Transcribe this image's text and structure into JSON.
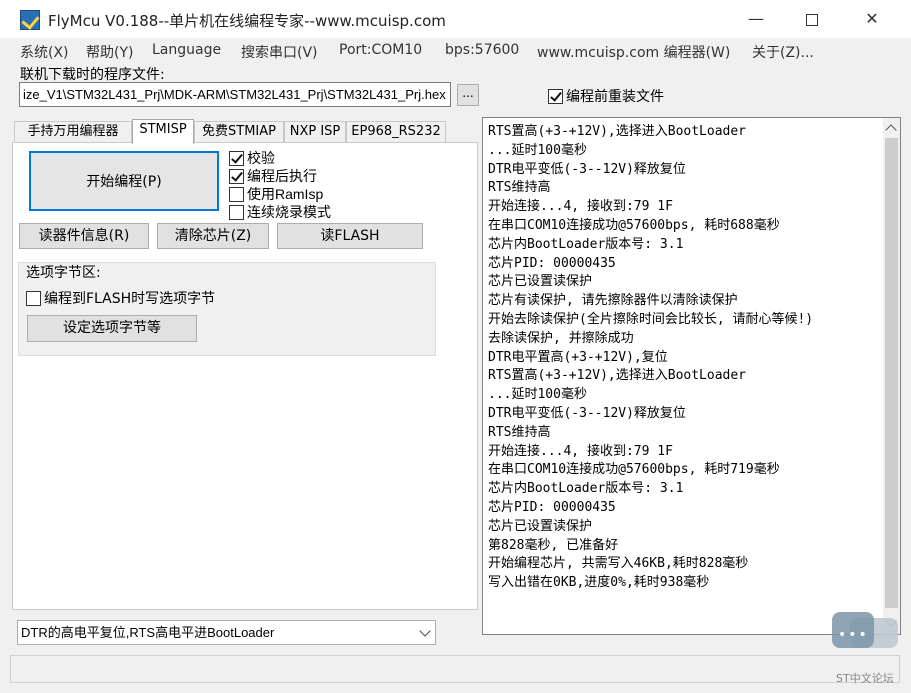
{
  "window": {
    "title": "FlyMcu V0.188--单片机在线编程专家--www.mcuisp.com",
    "minimize": "—",
    "close": "✕"
  },
  "menu": [
    "系统(X)",
    "帮助(Y)",
    "Language",
    "搜索串口(V)",
    "Port:COM10",
    "bps:57600",
    "www.mcuisp.com 编程器(W)",
    "关于(Z)..."
  ],
  "file": {
    "label": "联机下载时的程序文件:",
    "path": "ize_V1\\STM32L431_Prj\\MDK-ARM\\STM32L431_Prj\\STM32L431_Prj.hex",
    "browse": "...",
    "reload_label": "编程前重装文件",
    "reload_checked": true
  },
  "tabs": [
    "手持万用编程器",
    "STMISP",
    "免费STMIAP",
    "NXP ISP",
    "EP968_RS232"
  ],
  "active_tab": "STMISP",
  "stmisp": {
    "start_button": "开始编程(P)",
    "options": [
      {
        "label": "校验",
        "checked": true
      },
      {
        "label": "编程后执行",
        "checked": true
      },
      {
        "label": "使用RamIsp",
        "checked": false
      },
      {
        "label": "连续烧录模式",
        "checked": false
      }
    ],
    "read_info": "读器件信息(R)",
    "erase_chip": "清除芯片(Z)",
    "read_flash": "读FLASH",
    "option_group_title": "选项字节区:",
    "write_option_label": "编程到FLASH时写选项字节",
    "write_option_checked": false,
    "set_option_button": "设定选项字节等"
  },
  "reset_mode": "DTR的高电平复位,RTS高电平进BootLoader",
  "log_lines": [
    "RTS置高(+3-+12V),选择进入BootLoader",
    "...延时100毫秒",
    "DTR电平变低(-3--12V)释放复位",
    "RTS维持高",
    "开始连接...4, 接收到:79 1F",
    "在串口COM10连接成功@57600bps, 耗时688毫秒",
    "芯片内BootLoader版本号: 3.1",
    "芯片PID: 00000435",
    "芯片已设置读保护",
    "芯片有读保护, 请先擦除器件以清除读保护",
    "开始去除读保护(全片擦除时间会比较长, 请耐心等候!)",
    "去除读保护, 并擦除成功",
    "DTR电平置高(+3-+12V),复位",
    "RTS置高(+3-+12V),选择进入BootLoader",
    "...延时100毫秒",
    "DTR电平变低(-3--12V)释放复位",
    "RTS维持高",
    "开始连接...4, 接收到:79 1F",
    "在串口COM10连接成功@57600bps, 耗时719毫秒",
    "芯片内BootLoader版本号: 3.1",
    "芯片PID: 00000435",
    "芯片已设置读保护",
    "第828毫秒, 已准备好",
    "开始编程芯片, 共需写入46KB,耗时828毫秒",
    "写入出错在0KB,进度0%,耗时938毫秒"
  ],
  "watermark": "ST中文论坛",
  "colors": {
    "focus_border": "#0078d7",
    "window_bg": "#f0f0f0"
  }
}
